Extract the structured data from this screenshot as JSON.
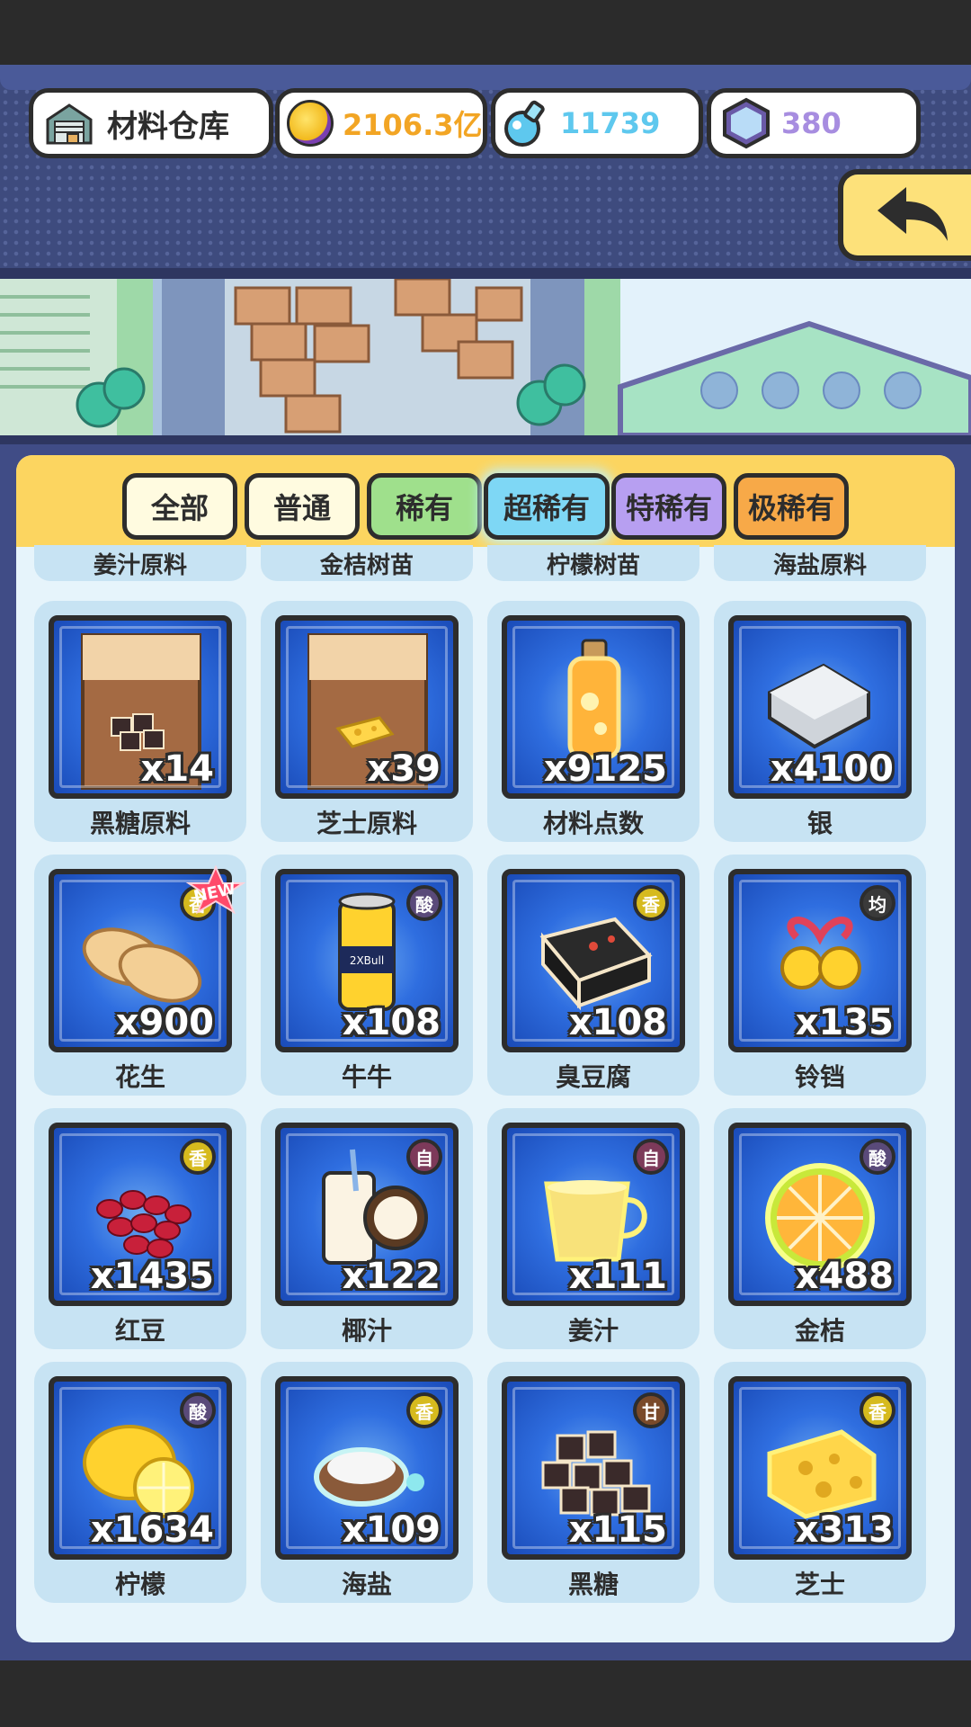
{
  "header": {
    "title": "材料仓库",
    "coins": "2106.3亿",
    "potions": "11739",
    "gems": "380"
  },
  "tabs": [
    "全部",
    "普通",
    "稀有",
    "超稀有",
    "特稀有",
    "极稀有"
  ],
  "active_tab": "超稀有",
  "partial_row": [
    "姜汁原料",
    "金桔树苗",
    "柠檬树苗",
    "海盐原料"
  ],
  "items": [
    {
      "name": "黑糖原料",
      "qty": "x14",
      "badge": ""
    },
    {
      "name": "芝士原料",
      "qty": "x39",
      "badge": ""
    },
    {
      "name": "材料点数",
      "qty": "x9125",
      "badge": ""
    },
    {
      "name": "银",
      "qty": "x4100",
      "badge": ""
    },
    {
      "name": "花生",
      "qty": "x900",
      "badge": "香"
    },
    {
      "name": "牛牛",
      "qty": "x108",
      "badge": "酸"
    },
    {
      "name": "臭豆腐",
      "qty": "x108",
      "badge": "香"
    },
    {
      "name": "铃铛",
      "qty": "x135",
      "badge": "均"
    },
    {
      "name": "红豆",
      "qty": "x1435",
      "badge": "香"
    },
    {
      "name": "椰汁",
      "qty": "x122",
      "badge": "自"
    },
    {
      "name": "姜汁",
      "qty": "x111",
      "badge": "自"
    },
    {
      "name": "金桔",
      "qty": "x488",
      "badge": "酸"
    },
    {
      "name": "柠檬",
      "qty": "x1634",
      "badge": "酸"
    },
    {
      "name": "海盐",
      "qty": "x109",
      "badge": "香"
    },
    {
      "name": "黑糖",
      "qty": "x115",
      "badge": "甘"
    },
    {
      "name": "芝士",
      "qty": "x313",
      "badge": "香"
    }
  ],
  "new_label": "NEW",
  "can_label": "2XBull",
  "colors": {
    "accent": "#fcd560",
    "panel": "#404c86",
    "slot": "#2f6ee0"
  }
}
